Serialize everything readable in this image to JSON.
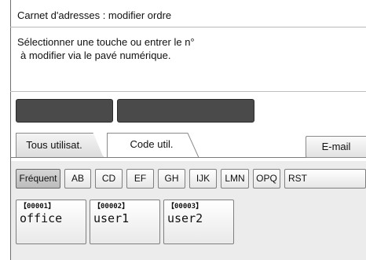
{
  "window": {
    "title": "Carnet d'adresses : modifier ordre"
  },
  "instruction": {
    "line1": "Sélectionner une touche ou entrer le n°",
    "line2": "à modifier via le pavé numérique."
  },
  "display": {
    "field1": "______",
    "field2": ""
  },
  "tabs": [
    {
      "label": "Tous utilisat.",
      "selected": true
    },
    {
      "label": "Code util.",
      "selected": false
    }
  ],
  "email_button": "E-mail",
  "index_keys": [
    {
      "label": "Fréquent",
      "selected": true
    },
    {
      "label": "AB",
      "selected": false
    },
    {
      "label": "CD",
      "selected": false
    },
    {
      "label": "EF",
      "selected": false
    },
    {
      "label": "GH",
      "selected": false
    },
    {
      "label": "IJK",
      "selected": false
    },
    {
      "label": "LMN",
      "selected": false
    },
    {
      "label": "OPQ",
      "selected": false
    },
    {
      "label": "RST",
      "selected": false
    }
  ],
  "entries": [
    {
      "code": "【00001】",
      "name": "office"
    },
    {
      "code": "【00002】",
      "name": "user1"
    },
    {
      "code": "【00003】",
      "name": "user2"
    }
  ]
}
